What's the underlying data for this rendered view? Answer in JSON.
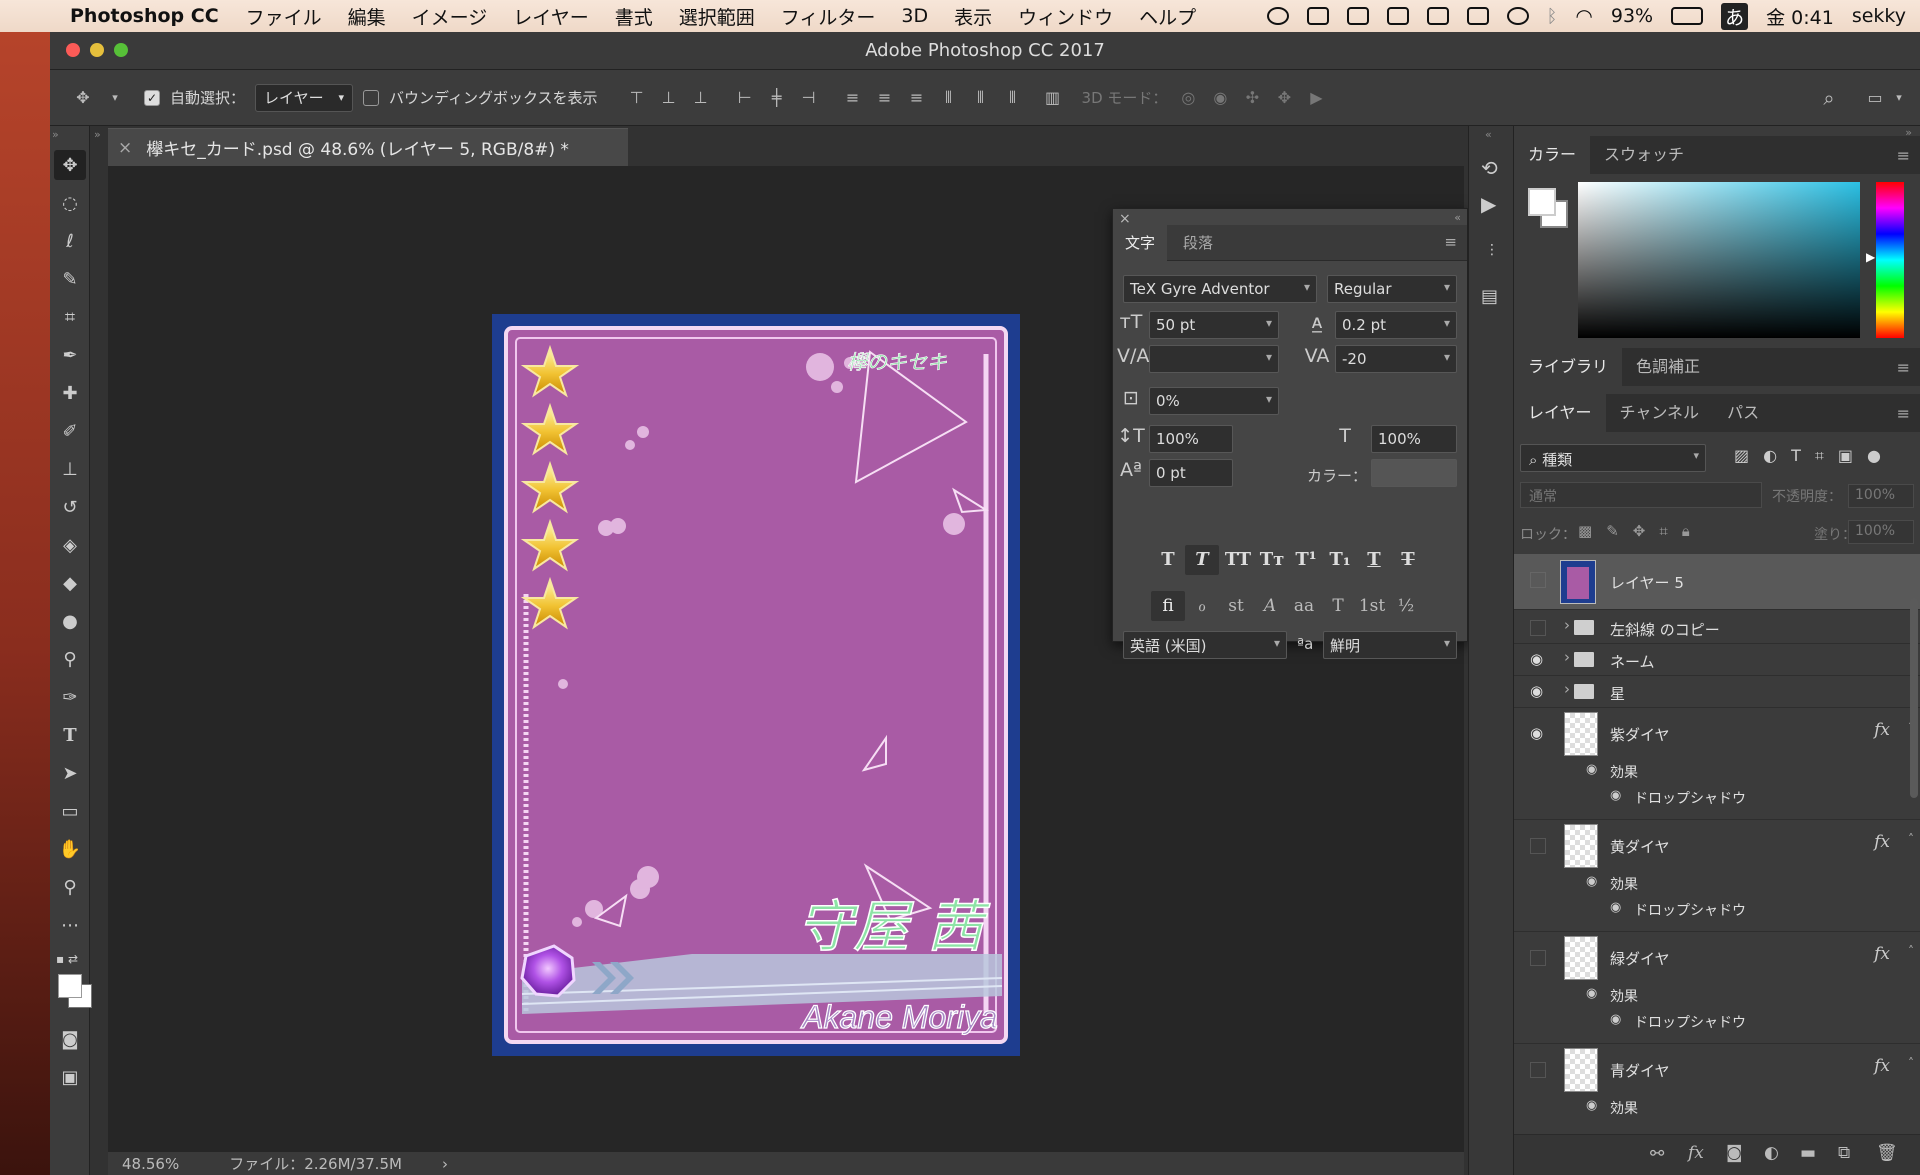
{
  "menubar": {
    "app": "Photoshop CC",
    "items": [
      "ファイル",
      "編集",
      "イメージ",
      "レイヤー",
      "書式",
      "選択範囲",
      "フィルター",
      "3D",
      "表示",
      "ウィンドウ",
      "ヘルプ"
    ],
    "battery": "93%",
    "ime": "あ",
    "clock": "金 0:41",
    "user": "sekky"
  },
  "window": {
    "title": "Adobe Photoshop CC 2017"
  },
  "options": {
    "autoselect_label": "自動選択：",
    "autoselect_value": "レイヤー",
    "bbox_label": "バウンディングボックスを表示",
    "mode3d_label": "3D モード："
  },
  "document": {
    "tab": "欅キセ_カード.psd @ 48.6% (レイヤー 5, RGB/8#) *",
    "zoom": "48.56%",
    "file_info": "ファイル：2.26M/37.5M"
  },
  "card": {
    "logo": "欅のキセキ",
    "name_jp": "守屋 茜",
    "name_en": "Akane Moriya",
    "stars": 5
  },
  "character_panel": {
    "tabs": [
      "文字",
      "段落"
    ],
    "font_family": "TeX Gyre Adventor",
    "font_style": "Regular",
    "size": "50 pt",
    "leading": "0.2 pt",
    "kerning": "",
    "tracking": "-20",
    "tsume": "0%",
    "vscale": "100%",
    "hscale": "100%",
    "baseline": "0 pt",
    "color_label": "カラー：",
    "language": "英語 (米国)",
    "aa_label": "ªa",
    "antialias": "鮮明"
  },
  "color_panel": {
    "tabs": [
      "カラー",
      "スウォッチ"
    ]
  },
  "library_panel": {
    "tabs": [
      "ライブラリ",
      "色調補正"
    ]
  },
  "layers_panel": {
    "tabs": [
      "レイヤー",
      "チャンネル",
      "パス"
    ],
    "filter": "種類",
    "blend": "通常",
    "opacity_label": "不透明度：",
    "opacity": "100%",
    "lock_label": "ロック：",
    "fill_label": "塗り：",
    "fill": "100%",
    "layers": [
      {
        "name": "レイヤー 5",
        "type": "image",
        "visible": false,
        "selected": true
      },
      {
        "name": "左斜線 のコピー",
        "type": "group",
        "visible": false
      },
      {
        "name": "ネーム",
        "type": "group",
        "visible": true
      },
      {
        "name": "星",
        "type": "group",
        "visible": true
      },
      {
        "name": "紫ダイヤ",
        "type": "fx",
        "visible": true,
        "effects_label": "効果",
        "effect": "ドロップシャドウ"
      },
      {
        "name": "黄ダイヤ",
        "type": "fx",
        "visible": false,
        "effects_label": "効果",
        "effect": "ドロップシャドウ"
      },
      {
        "name": "緑ダイヤ",
        "type": "fx",
        "visible": false,
        "effects_label": "効果",
        "effect": "ドロップシャドウ"
      },
      {
        "name": "青ダイヤ",
        "type": "fx",
        "visible": false,
        "effects_label": "効果"
      }
    ]
  }
}
